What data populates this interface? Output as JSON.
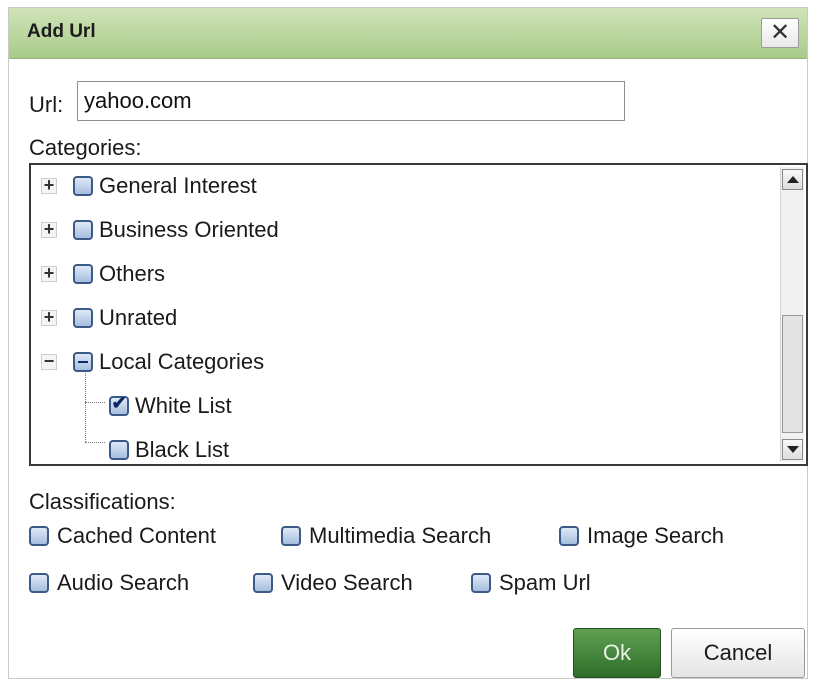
{
  "dialog": {
    "title": "Add Url",
    "close_glyph": "✕"
  },
  "url": {
    "label": "Url:",
    "value": "yahoo.com"
  },
  "categories": {
    "label": "Categories:",
    "items": [
      {
        "label": "General Interest",
        "expander": "+",
        "state": "unchecked"
      },
      {
        "label": "Business Oriented",
        "expander": "+",
        "state": "unchecked"
      },
      {
        "label": "Others",
        "expander": "+",
        "state": "unchecked"
      },
      {
        "label": "Unrated",
        "expander": "+",
        "state": "unchecked"
      },
      {
        "label": "Local Categories",
        "expander": "−",
        "state": "partial"
      },
      {
        "label": "White List",
        "state": "checked"
      },
      {
        "label": "Black List",
        "state": "unchecked"
      }
    ]
  },
  "classifications": {
    "label": "Classifications:",
    "items": [
      {
        "label": "Cached Content",
        "checked": false
      },
      {
        "label": "Multimedia Search",
        "checked": false
      },
      {
        "label": "Image Search",
        "checked": false
      },
      {
        "label": "Audio Search",
        "checked": false
      },
      {
        "label": "Video Search",
        "checked": false
      },
      {
        "label": "Spam Url",
        "checked": false
      }
    ]
  },
  "buttons": {
    "ok": "Ok",
    "cancel": "Cancel"
  },
  "colors": {
    "titlebar": "#a9cb8a",
    "ok_button": "#3f8537",
    "checkbox": "#a6bedf"
  }
}
